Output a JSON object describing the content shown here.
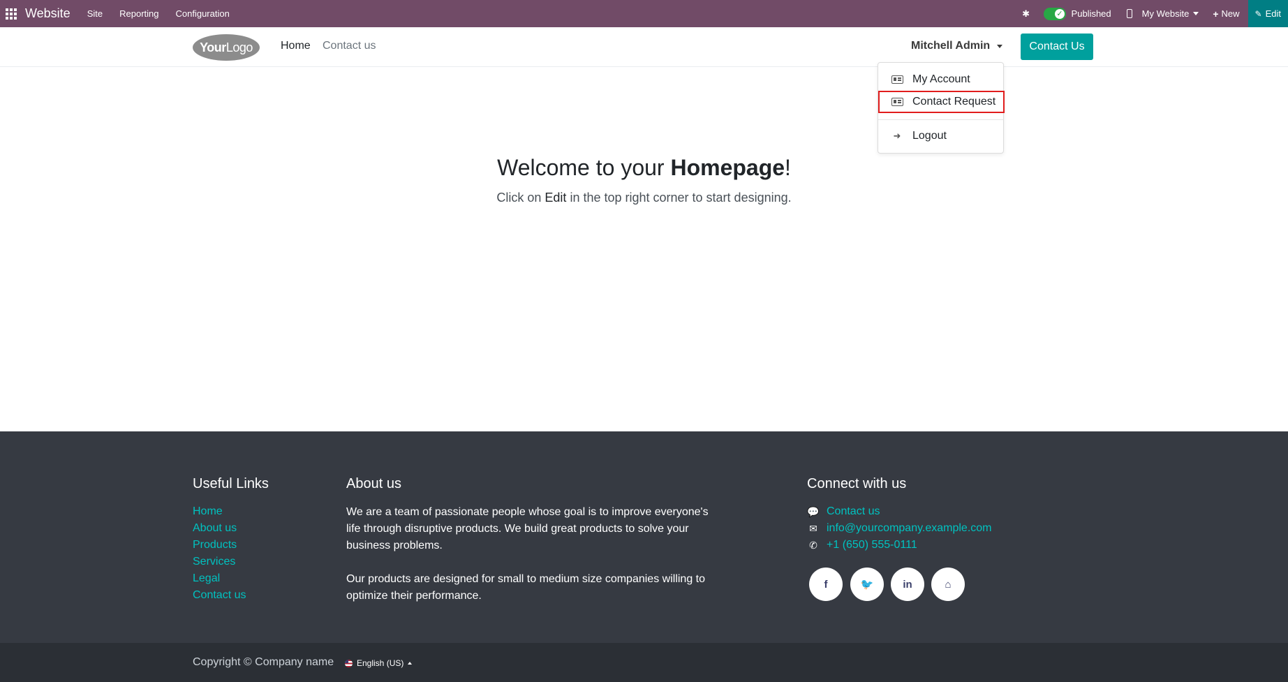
{
  "admin_bar": {
    "app_name": "Website",
    "menus": [
      "Site",
      "Reporting",
      "Configuration"
    ],
    "published_label": "Published",
    "website_selector": "My Website",
    "new_label": "New",
    "edit_label": "Edit",
    "bar_color": "#714b67",
    "edit_color": "#017e84"
  },
  "header": {
    "logo_text_bold": "Your",
    "logo_text": "Logo",
    "nav": [
      "Home",
      "Contact us"
    ],
    "user_name": "Mitchell Admin",
    "cta_label": "Contact Us",
    "cta_color": "#00a09d"
  },
  "user_dropdown": {
    "items": [
      "My Account",
      "Contact Request",
      "Logout"
    ],
    "highlighted": "Contact Request"
  },
  "main": {
    "welcome_prefix": "Welcome to your ",
    "welcome_bold": "Homepage",
    "welcome_suffix": "!",
    "subtitle_prefix": "Click on ",
    "subtitle_edit": "Edit",
    "subtitle_suffix": " in the top right corner to start designing."
  },
  "footer": {
    "useful_links_title": "Useful Links",
    "useful_links": [
      "Home",
      "About us",
      "Products",
      "Services",
      "Legal",
      "Contact us"
    ],
    "about_title": "About us",
    "about_p1": "We are a team of passionate people whose goal is to improve everyone's life through disruptive products. We build great products to solve your business problems.",
    "about_p2": "Our products are designed for small to medium size companies willing to optimize their performance.",
    "connect_title": "Connect with us",
    "contact_link": "Contact us",
    "email": "info@yourcompany.example.com",
    "phone": "+1 (650) 555-0111",
    "social_icons": [
      "facebook-icon",
      "twitter-icon",
      "linkedin-icon",
      "home-icon"
    ],
    "social_glyphs": [
      "f",
      "🐦",
      "in",
      "⌂"
    ],
    "link_color": "#00c2c0",
    "background": "#363a42"
  },
  "copyright": {
    "text": "Copyright © Company name",
    "language": "English (US)"
  }
}
